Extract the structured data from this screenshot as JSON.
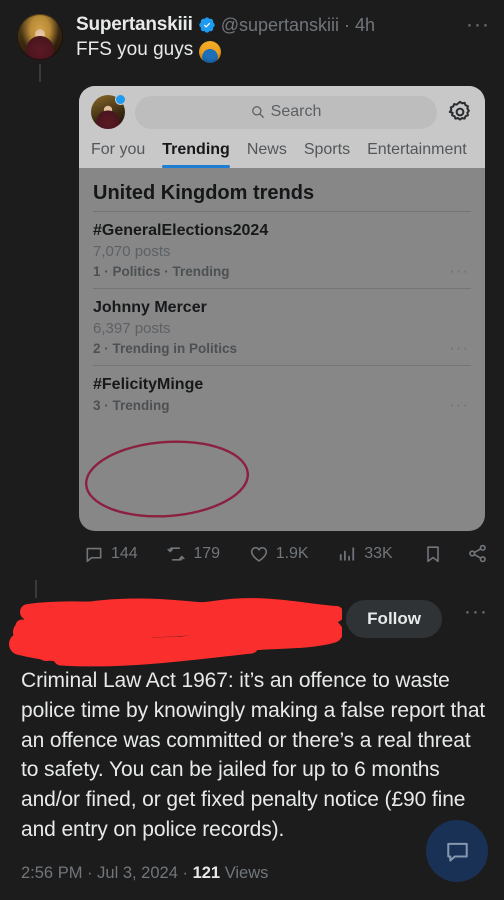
{
  "tweet_header": {
    "display_name": "Supertanskiii",
    "verified_icon": "verified-badge-icon",
    "handle": "@supertanskiii",
    "separator": "·",
    "age": "4h",
    "more_menu": "···",
    "text": "FFS you guys",
    "emoji": "face-palm-emoji"
  },
  "embedded_screenshot": {
    "search": {
      "icon": "search-icon",
      "placeholder": "Search"
    },
    "settings_icon": "gear-icon",
    "avatar_badge": "blue-dot-badge",
    "tabs": [
      {
        "label": "For you",
        "active": false
      },
      {
        "label": "Trending",
        "active": true
      },
      {
        "label": "News",
        "active": false
      },
      {
        "label": "Sports",
        "active": false
      },
      {
        "label": "Entertainment",
        "active": false
      }
    ],
    "section_title": "United Kingdom trends",
    "trends": [
      {
        "name": "#GeneralElections2024",
        "posts": "7,070 posts",
        "meta": "1 · Politics · Trending",
        "more": "···",
        "circled": false
      },
      {
        "name": "Johnny Mercer",
        "posts": "6,397 posts",
        "meta": "2 · Trending in Politics",
        "more": "···",
        "circled": false
      },
      {
        "name": "#FelicityMinge",
        "posts": "",
        "meta": "3 · Trending",
        "more": "···",
        "circled": true
      }
    ],
    "annotation_circle_color": "#8B2040"
  },
  "engagement": {
    "reply": {
      "icon": "reply-icon",
      "count": "144"
    },
    "repost": {
      "icon": "repost-icon",
      "count": "179"
    },
    "like": {
      "icon": "heart-icon",
      "count": "1.9K"
    },
    "views": {
      "icon": "analytics-icon",
      "count": "33K"
    },
    "bookmark": {
      "icon": "bookmark-icon",
      "count": ""
    },
    "share": {
      "icon": "share-icon",
      "count": ""
    }
  },
  "quoted_author": {
    "redaction_color": "#FB2E2E",
    "redaction_note": "red-scribble-redaction",
    "follow_label": "Follow",
    "more_menu": "···"
  },
  "main_tweet": {
    "text": "Criminal Law Act 1967: it’s an offence to waste police time by knowingly making a false report that an offence was committed or there’s a real threat to safety. You can be jailed for up to 6 months and/or fined, or get fixed penalty notice (£90 fine and entry on police records).",
    "time": "2:56 PM",
    "sep1": "·",
    "date": "Jul 3, 2024",
    "sep2": "·",
    "views_count": "121",
    "views_label": "Views"
  },
  "fab": {
    "icon": "compose-message-icon"
  },
  "colors": {
    "page_background": "#1c1c1c",
    "text_primary": "#e7e9ea",
    "text_secondary": "#71767b",
    "accent_blue": "#1d9bf0",
    "card_body": "#878787",
    "card_top": "#c8c8c8"
  }
}
